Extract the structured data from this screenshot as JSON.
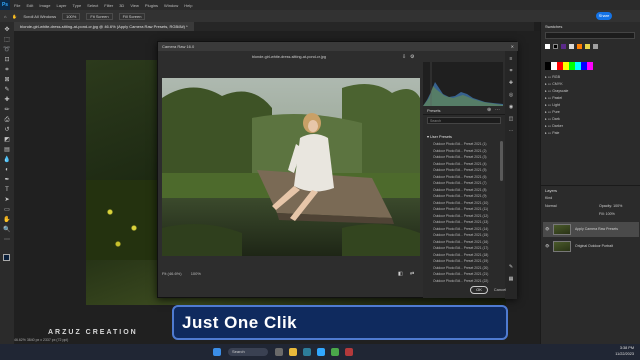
{
  "menubar": {
    "app_logo": "Ps",
    "items": [
      "File",
      "Edit",
      "Image",
      "Layer",
      "Type",
      "Select",
      "Filter",
      "3D",
      "View",
      "Plugins",
      "Window",
      "Help"
    ]
  },
  "options": {
    "scroll_all": "Scroll All Windows",
    "zoom": "100%",
    "fit": "Fit Screen",
    "fill": "Fill Screen",
    "share": "Share"
  },
  "document": {
    "tab": "blonde-girl-white-dress-sitting-at-pond-cr.jpg @ 46.6% (Apply Camera Raw Presets, RGB/8#) *",
    "status": "46.62%   3840 px x 2337 px (72 ppi)"
  },
  "camera_raw": {
    "title": "Camera Raw 16.0",
    "filename": "blonde-girl-white-dress-sitting-at-pond-cr.jpg",
    "zoom_fit": "Fit (46.6%)",
    "zoom_pct": "100%",
    "presets_title": "Presets",
    "search_placeholder": "Search",
    "group": "User Presets",
    "preset_items": [
      "Outdoor Photo Edi... Preset 2021 (1)",
      "Outdoor Photo Edi... Preset 2021 (2)",
      "Outdoor Photo Edi... Preset 2021 (3)",
      "Outdoor Photo Edi... Preset 2021 (4)",
      "Outdoor Photo Edi... Preset 2021 (5)",
      "Outdoor Photo Edi... Preset 2021 (6)",
      "Outdoor Photo Edi... Preset 2021 (7)",
      "Outdoor Photo Edi... Preset 2021 (8)",
      "Outdoor Photo Edi... Preset 2021 (9)",
      "Outdoor Photo Edi... Preset 2021 (10)",
      "Outdoor Photo Edi... Preset 2021 (11)",
      "Outdoor Photo Edi... Preset 2021 (12)",
      "Outdoor Photo Edi... Preset 2021 (13)",
      "Outdoor Photo Edi... Preset 2021 (14)",
      "Outdoor Photo Edi... Preset 2021 (15)",
      "Outdoor Photo Edi... Preset 2021 (16)",
      "Outdoor Photo Edi... Preset 2021 (17)",
      "Outdoor Photo Edi... Preset 2021 (18)",
      "Outdoor Photo Edi... Preset 2021 (19)",
      "Outdoor Photo Edi... Preset 2021 (20)",
      "Outdoor Photo Edi... Preset 2021 (21)",
      "Outdoor Photo Edi... Preset 2021 (22)"
    ],
    "ok": "OK",
    "cancel": "Cancel"
  },
  "swatches": {
    "title": "Swatches",
    "colors": [
      "#000000",
      "#ffffff",
      "#ff0000",
      "#ffff00",
      "#00ff00",
      "#00ffff",
      "#0000ff",
      "#ff00ff"
    ],
    "folders": [
      "RGB",
      "CMYK",
      "Grayscale",
      "Pastel",
      "Light",
      "Pure",
      "Dark",
      "Darker",
      "Pale"
    ]
  },
  "layers": {
    "title": "Layers",
    "kind": "Kind",
    "mode": "Normal",
    "opacity": "Opacity: 100%",
    "fill": "Fill: 100%",
    "items": [
      {
        "name": "Apply Camera Raw Presets"
      },
      {
        "name": "Original Outdoor Portrait"
      }
    ]
  },
  "watermark": "ARZUZ CREATION",
  "caption": "Just One Clik",
  "taskbar": {
    "search": "Search",
    "time": "3:38 PM",
    "date": "11/22/2023"
  }
}
